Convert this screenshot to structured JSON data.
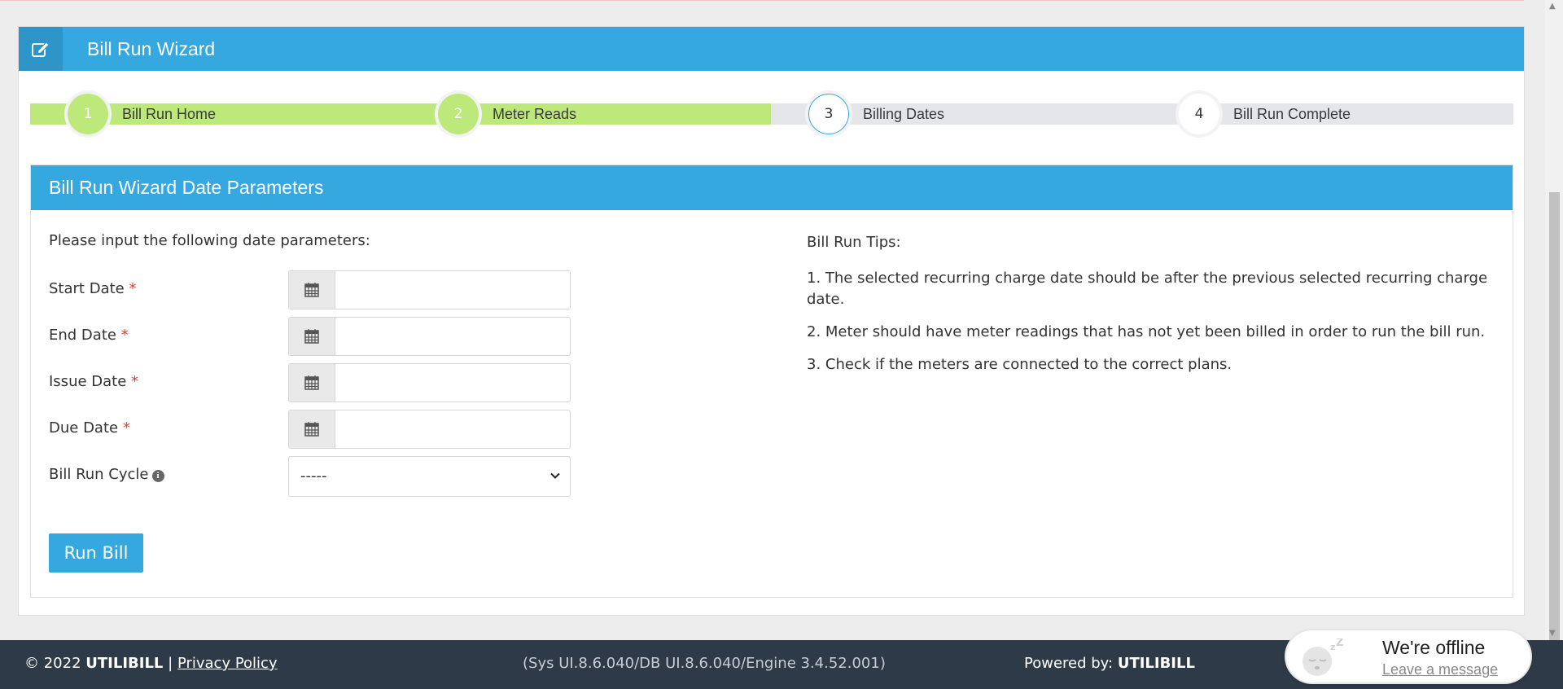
{
  "panel": {
    "title": "Bill Run Wizard",
    "icon": "edit-icon"
  },
  "wizard": {
    "steps": [
      {
        "number": "1",
        "label": "Bill Run Home",
        "state": "done"
      },
      {
        "number": "2",
        "label": "Meter Reads",
        "state": "done"
      },
      {
        "number": "3",
        "label": "Billing Dates",
        "state": "active"
      },
      {
        "number": "4",
        "label": "Bill Run Complete",
        "state": "pending"
      }
    ]
  },
  "form": {
    "heading": "Bill Run Wizard Date Parameters",
    "intro": "Please input the following date parameters:",
    "required_mark": "*",
    "fields": [
      {
        "label": "Start Date",
        "value": ""
      },
      {
        "label": "End Date",
        "value": ""
      },
      {
        "label": "Issue Date",
        "value": ""
      },
      {
        "label": "Due Date",
        "value": ""
      }
    ],
    "cycle": {
      "label": "Bill Run Cycle",
      "selected": "-----"
    },
    "submit_label": "Run Bill"
  },
  "tips": {
    "title": "Bill Run Tips:",
    "items": [
      "1. The selected recurring charge date should be after the previous selected recurring charge date.",
      "2. Meter should have meter readings that has not yet been billed in order to run the bill run.",
      "3. Check if the meters are connected to the correct plans."
    ]
  },
  "footer": {
    "copyright": "© 2022",
    "brand": "UTILIBILL",
    "separator": "|",
    "privacy": "Privacy Policy",
    "version": "(Sys UI.8.6.040/DB UI.8.6.040/Engine 3.4.52.001)",
    "powered_label": "Powered by:",
    "powered_brand": "UTILIBILL"
  },
  "chat": {
    "status": "We're offline",
    "link": "Leave a message"
  },
  "colors": {
    "primary": "#35a8e0",
    "done": "#bde97a",
    "pending": "#e5e6ea",
    "footer": "#2f3a48",
    "required": "#e53935"
  }
}
